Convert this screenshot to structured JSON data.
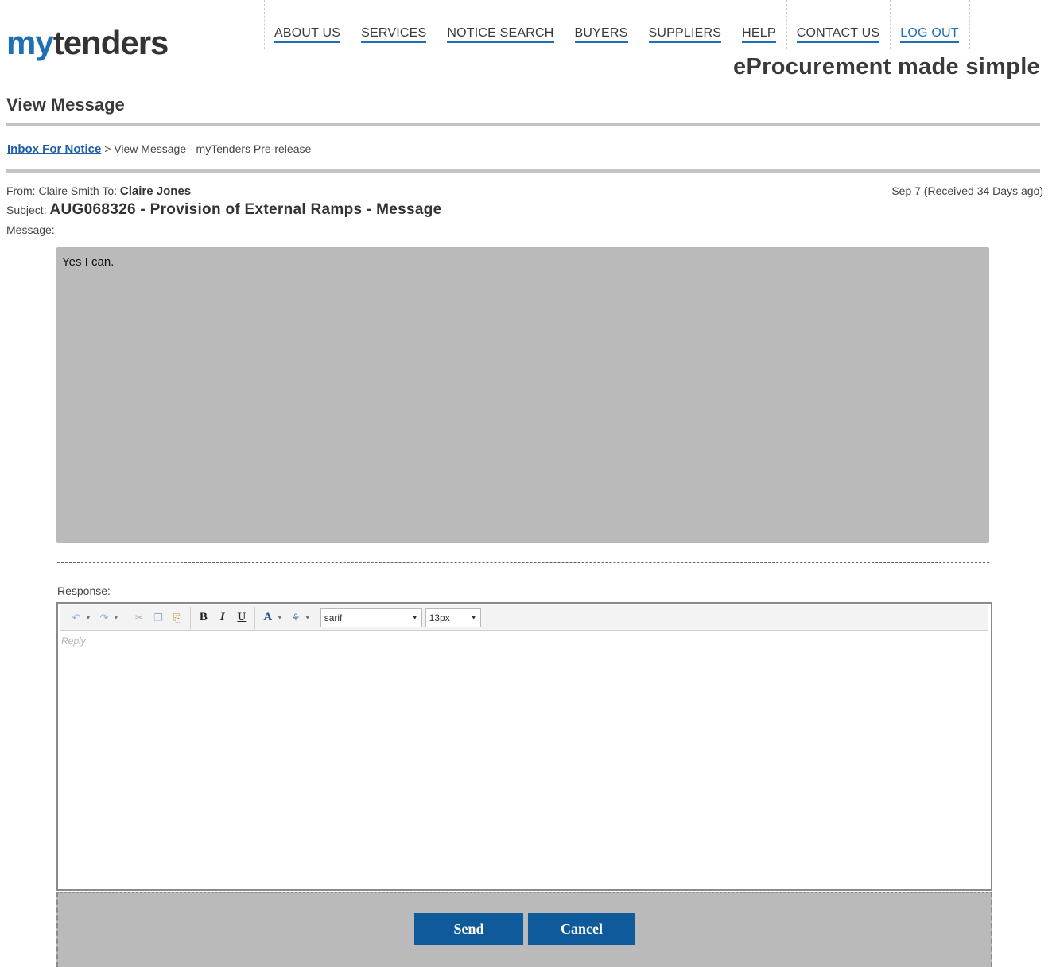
{
  "logo": {
    "part1": "my",
    "part2": "tenders"
  },
  "nav": [
    {
      "label": "ABOUT US"
    },
    {
      "label": "SERVICES"
    },
    {
      "label": "NOTICE SEARCH"
    },
    {
      "label": "BUYERS"
    },
    {
      "label": "SUPPLIERS"
    },
    {
      "label": "HELP"
    },
    {
      "label": "CONTACT US"
    },
    {
      "label": "LOG OUT"
    }
  ],
  "tagline": "eProcurement made simple",
  "page_title": "View Message",
  "breadcrumb": {
    "link": "Inbox For Notice",
    "separator": ">",
    "current": "View Message - myTenders Pre-release"
  },
  "message": {
    "from_label": "From:",
    "from": "Claire Smith",
    "to_label": "To:",
    "to": "Claire Jones",
    "date": "Sep 7 (Received 34 Days ago)",
    "subject_label": "Subject:",
    "subject": "AUG068326 - Provision of External Ramps - Message",
    "message_label": "Message:",
    "body": "Yes I can."
  },
  "response": {
    "label": "Response:",
    "placeholder": "Reply",
    "font_value": "sarif",
    "size_value": "13px"
  },
  "buttons": {
    "send": "Send",
    "cancel": "Cancel"
  },
  "colors": {
    "brand_blue": "#1f6fb5",
    "button_blue": "#0e5a9a",
    "panel_gray": "#bababa"
  }
}
